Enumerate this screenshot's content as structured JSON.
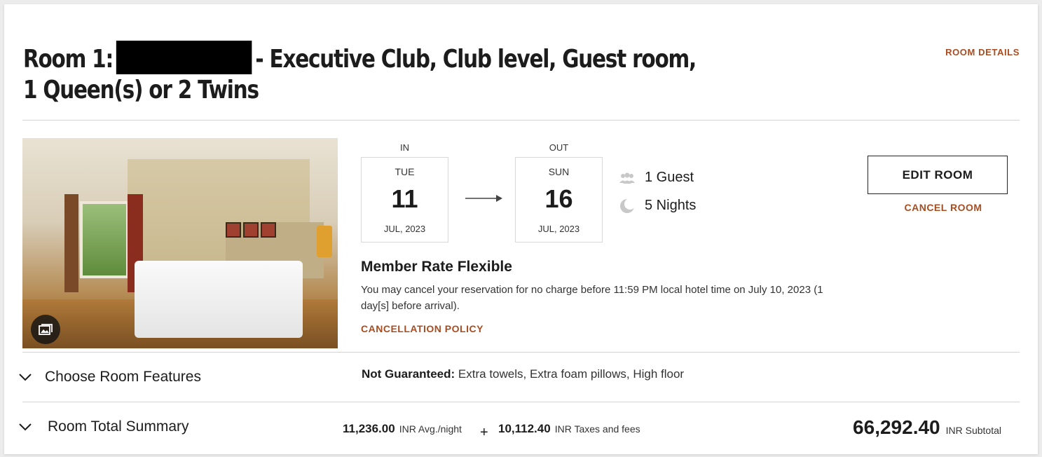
{
  "room": {
    "title_prefix": "Room 1:",
    "title_suffix": "- Executive Club, Club level, Guest room, 1 Queen(s) or 2 Twins",
    "details_link": "ROOM DETAILS"
  },
  "stay": {
    "check_in": {
      "label": "IN",
      "dow": "TUE",
      "day": "11",
      "month_year": "JUL, 2023"
    },
    "check_out": {
      "label": "OUT",
      "dow": "SUN",
      "day": "16",
      "month_year": "JUL, 2023"
    },
    "guests": "1 Guest",
    "nights": "5 Nights"
  },
  "actions": {
    "edit_room": "EDIT ROOM",
    "cancel_room": "CANCEL ROOM"
  },
  "rate": {
    "title": "Member Rate Flexible",
    "description": "You may cancel your reservation for no charge before 11:59 PM local hotel time on July 10, 2023 (1 day[s] before arrival).",
    "cancellation_policy": "CANCELLATION POLICY"
  },
  "features": {
    "toggle_label": "Choose Room Features",
    "not_guaranteed_label": "Not Guaranteed:",
    "not_guaranteed_items": "Extra towels, Extra foam pillows, High floor"
  },
  "summary": {
    "toggle_label": "Room Total Summary",
    "avg_night_amount": "11,236.00",
    "avg_night_unit": "INR Avg./night",
    "plus": "+",
    "taxes_amount": "10,112.40",
    "taxes_unit": "INR Taxes and fees",
    "subtotal_amount": "66,292.40",
    "subtotal_unit": "INR Subtotal"
  },
  "icons": {
    "gallery": "gallery-icon",
    "guests": "guests-icon",
    "nights": "moon-icon",
    "arrow": "arrow-right-icon",
    "chevron": "chevron-down-icon"
  },
  "colors": {
    "accent": "#a84d22",
    "text": "#1c1c1c",
    "divider": "#d4d4d4"
  }
}
